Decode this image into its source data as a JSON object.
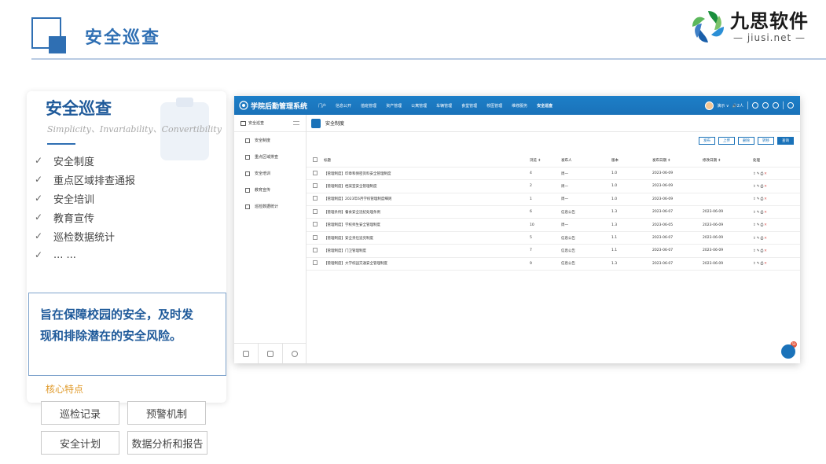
{
  "header": {
    "title": "安全巡查",
    "logo_cn": "九思软件",
    "logo_en": "— jiusi.net —"
  },
  "card": {
    "title": "安全巡查",
    "subtitle": "Simplicity、Invariability、Convertibility",
    "features": [
      "安全制度",
      "重点区域排查通报",
      "安全培训",
      "教育宣传",
      "巡检数据统计",
      "... ..."
    ],
    "highlight_line1": "旨在保障校园的安全，及时发",
    "highlight_line2": "现和排除潜在的安全风险。",
    "core_label": "核心特点",
    "tags": [
      "巡检记录",
      "预警机制",
      "安全计划",
      "数据分析和报告"
    ]
  },
  "app": {
    "system_name": "学院后勤管理系统",
    "nav": [
      "门户",
      "信息公开",
      "值班管理",
      "资产管理",
      "公寓管理",
      "车辆管理",
      "食堂管理",
      "校医管理",
      "维修服务",
      "安全巡查"
    ],
    "active_nav": "安全巡查",
    "user_name": "演示 ∨",
    "user_info": "🔊2人",
    "sidebar_header": "安全巡查",
    "sidebar_items": [
      "安全制度",
      "重点区域排查",
      "安全培训",
      "教育宣传",
      "巡检数据统计"
    ],
    "page_title": "安全制度",
    "actions": [
      "发布",
      "上传",
      "删除",
      "转移",
      "查询"
    ],
    "columns": [
      "标题",
      "浏览 ⇕",
      "发布人",
      "版本",
      "发布日期 ⇕",
      "修改日期 ⇕",
      "处理"
    ],
    "rows": [
      [
        "【管理制度】印章和保密资料安全管理制度",
        "4",
        "周一",
        "1.0",
        "2023-06-09",
        ""
      ],
      [
        "【管理制度】档案室安全管理制度",
        "2",
        "周一",
        "1.0",
        "2023-06-09",
        ""
      ],
      [
        "【管理制度】2023年6月学校管理制度细则",
        "1",
        "周一",
        "1.0",
        "2023-06-09",
        ""
      ],
      [
        "【管理条例】餐食安全违纪处理条例",
        "6",
        "信息公告",
        "1.3",
        "2023-06-07",
        "2023-06-09"
      ],
      [
        "【管理制度】学校师生安全管理制度",
        "10",
        "周一",
        "1.3",
        "2023-06-05",
        "2023-06-09"
      ],
      [
        "【管理制度】安全责任追究制度",
        "5",
        "信息公告",
        "1.1",
        "2023-06-07",
        "2023-06-09"
      ],
      [
        "【管理制度】门卫管理制度",
        "7",
        "信息公告",
        "1.1",
        "2023-06-07",
        "2023-06-09"
      ],
      [
        "【管理制度】大学校园交通安全管理制度",
        "9",
        "信息公告",
        "1.3",
        "2023-06-07",
        "2023-06-09"
      ]
    ],
    "fab_badge": "50"
  },
  "colors": {
    "brand_blue": "#2f6fb3",
    "topbar_blue": "#1a72b9",
    "core_orange": "#e09a2a",
    "delete_red": "#d9534f"
  },
  "icons": [
    "checkmark-icon",
    "home-icon",
    "menu-icon",
    "document-icon",
    "edit-icon",
    "print-icon",
    "delete-icon",
    "user-icon",
    "grid-icon",
    "settings-icon",
    "power-icon"
  ]
}
